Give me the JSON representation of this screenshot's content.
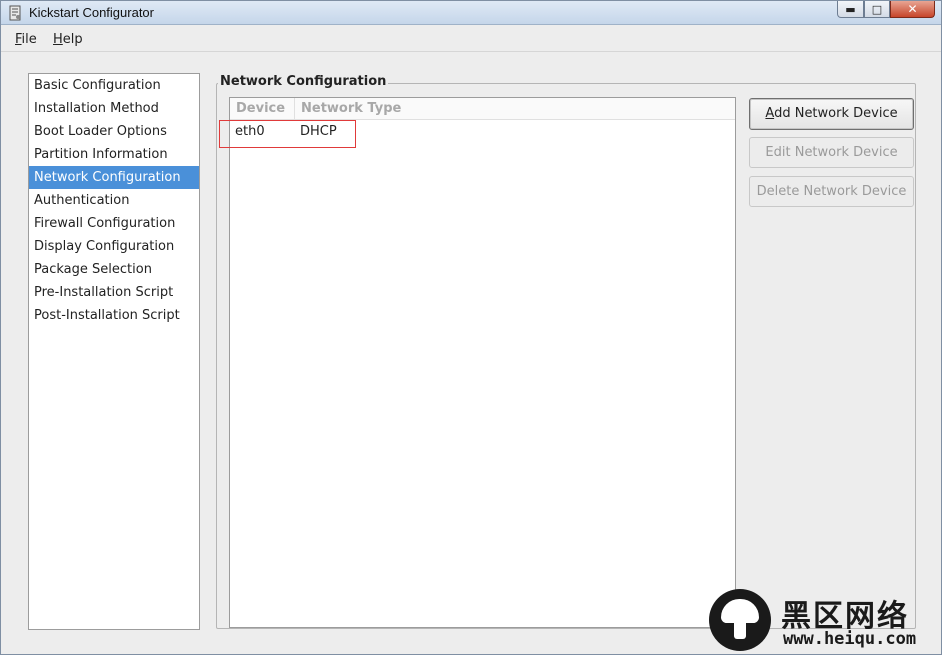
{
  "window": {
    "title": "Kickstart Configurator"
  },
  "menu": {
    "file": {
      "accel": "F",
      "rest": "ile"
    },
    "help": {
      "accel": "H",
      "rest": "elp"
    }
  },
  "sidebar": {
    "items": [
      {
        "label": "Basic Configuration",
        "selected": false
      },
      {
        "label": "Installation Method",
        "selected": false
      },
      {
        "label": "Boot Loader Options",
        "selected": false
      },
      {
        "label": "Partition Information",
        "selected": false
      },
      {
        "label": "Network Configuration",
        "selected": true
      },
      {
        "label": "Authentication",
        "selected": false
      },
      {
        "label": "Firewall Configuration",
        "selected": false
      },
      {
        "label": "Display Configuration",
        "selected": false
      },
      {
        "label": "Package Selection",
        "selected": false
      },
      {
        "label": "Pre-Installation Script",
        "selected": false
      },
      {
        "label": "Post-Installation Script",
        "selected": false
      }
    ]
  },
  "network": {
    "section_title": "Network Configuration",
    "columns": {
      "device": "Device",
      "type": "Network Type"
    },
    "rows": [
      {
        "device": "eth0",
        "type": "DHCP"
      }
    ],
    "buttons": {
      "add": {
        "accel": "A",
        "rest": "dd Network Device"
      },
      "edit": "Edit Network Device",
      "delete": "Delete Network Device"
    }
  },
  "watermark": {
    "text_cn": "黑区网络",
    "url": "www.heiqu.com"
  },
  "colors": {
    "selection": "#4a90d9",
    "highlight_box": "#e03a3a"
  }
}
